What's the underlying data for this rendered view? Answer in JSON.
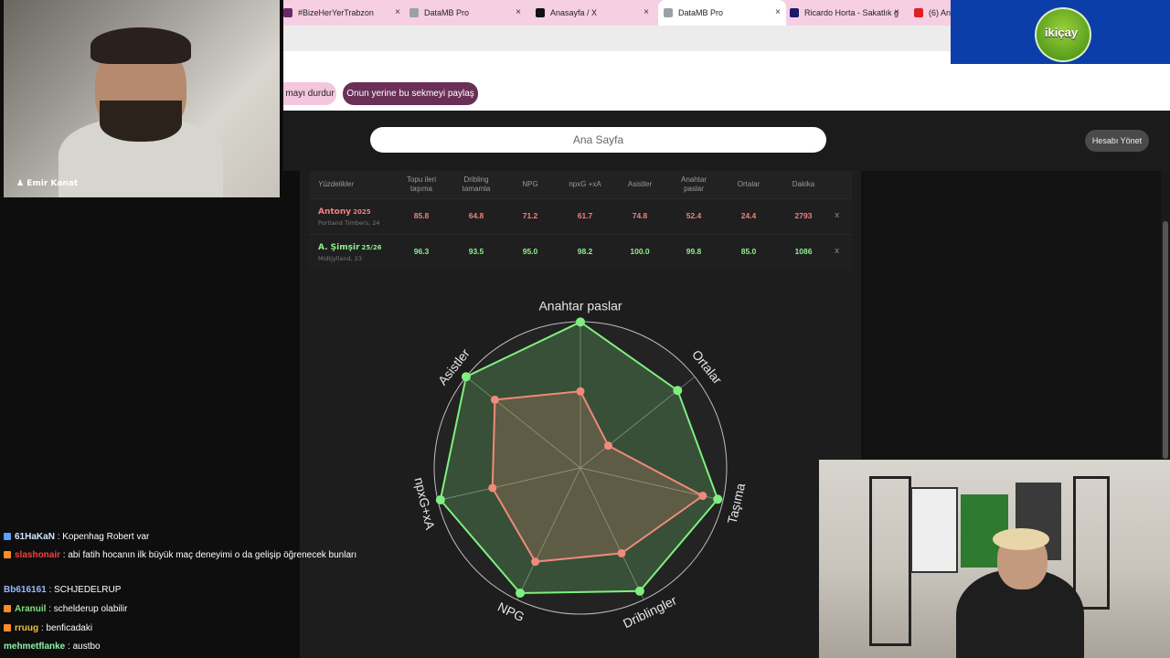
{
  "browser": {
    "tabs": [
      {
        "title": "#BizeHerYerTrabzon",
        "fav_color": "#6a2a6a"
      },
      {
        "title": "DataMB Pro",
        "fav_color": "#9aa0a6"
      },
      {
        "title": "Anasayfa / X",
        "fav_color": "#111111"
      },
      {
        "title": "DataMB Pro",
        "fav_color": "#9aa0a6"
      },
      {
        "title": "Ricardo Horta - Sakatlık g",
        "fav_color": "#1a1a6a"
      },
      {
        "title": "(6) An",
        "fav_color": "#e02020"
      }
    ],
    "close_glyph": "×",
    "share_stop_label": "mayı durdur",
    "share_instead_label": "Onun yerine bu sekmeyi paylaş"
  },
  "sponsor": {
    "name": "ikiçay"
  },
  "webcam_top": {
    "name_tag": "Emir Kanat"
  },
  "app": {
    "search_placeholder": "Ana Sayfa",
    "account_label": "Hesabı Yönet",
    "table": {
      "headers": [
        "Yüzdelikler",
        "Topu ileri taşıma",
        "Dribling tamamla",
        "NPG",
        "npxG +xA",
        "Asistler",
        "Anahtar paslar",
        "Ortalar",
        "Dakika"
      ],
      "rows": [
        {
          "name": "Antony",
          "season": "2025",
          "team": "Portland Timbers, 24",
          "color": "#f08080",
          "values": [
            "85.8",
            "64.8",
            "71.2",
            "61.7",
            "74.8",
            "52.4",
            "24.4",
            "2793"
          ]
        },
        {
          "name": "A. Şimşir",
          "season": "25/26",
          "team": "Midtjylland, 23",
          "color": "#8ef08e",
          "values": [
            "96.3",
            "93.5",
            "95.0",
            "98.2",
            "100.0",
            "99.8",
            "85.0",
            "1086"
          ]
        }
      ],
      "remove_glyph": "x"
    }
  },
  "chart_data": {
    "type": "radar",
    "axes": [
      "Anahtar paslar",
      "Ortalar",
      "Taşıma",
      "Driblingler",
      "NPG",
      "npxG+xA",
      "Asistler"
    ],
    "range": [
      0,
      100
    ],
    "series": [
      {
        "name": "Antony",
        "color": "#f08a7a",
        "values": [
          52.4,
          24.4,
          85.8,
          64.8,
          71.2,
          61.7,
          74.8
        ]
      },
      {
        "name": "A. Şimşir",
        "color": "#7ff07f",
        "values": [
          99.8,
          85.0,
          96.3,
          93.5,
          95.0,
          98.2,
          100.0
        ]
      }
    ]
  },
  "chat": [
    {
      "user": "61HaKaN",
      "color": "#cfe8ff",
      "icon": "#5aa0ff",
      "text": "Kopenhag Robert var"
    },
    {
      "user": "slashonair",
      "color": "#ff3b3b",
      "icon": "#ff8a2a",
      "text": "abi fatih hocanın ilk büyük maç deneyimi o da gelişip öğrenecek bunları"
    },
    {
      "user": "Bb616161",
      "color": "#9ab8ff",
      "icon": "",
      "text": "SCHJEDELRUP"
    },
    {
      "user": "Aranuil",
      "color": "#7ee07e",
      "icon": "#ff8a2a",
      "text": "schelderup olabilir"
    },
    {
      "user": "rruug",
      "color": "#f0c040",
      "icon": "#ff8a2a",
      "text": "benficadaki"
    },
    {
      "user": "mehmetflanke",
      "color": "#8ef0a8",
      "icon": "",
      "text": "austbo"
    }
  ]
}
